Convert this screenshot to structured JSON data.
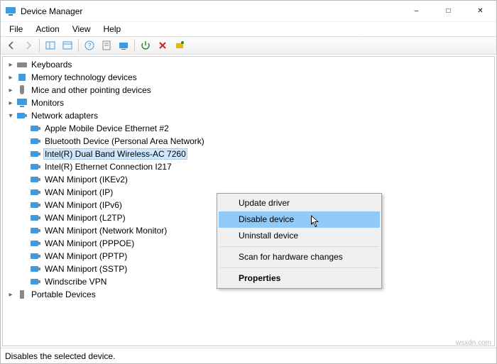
{
  "titlebar": {
    "title": "Device Manager"
  },
  "menubar": {
    "file": "File",
    "action": "Action",
    "view": "View",
    "help": "Help"
  },
  "tree": {
    "keyboards": "Keyboards",
    "memory_tech": "Memory technology devices",
    "mice": "Mice and other pointing devices",
    "monitors": "Monitors",
    "network_adapters": "Network adapters",
    "na_items": {
      "apple": "Apple Mobile Device Ethernet #2",
      "bt": "Bluetooth Device (Personal Area Network)",
      "intel_wireless": "Intel(R) Dual Band Wireless-AC 7260",
      "intel_eth": "Intel(R) Ethernet Connection I217",
      "wan_ikev2": "WAN Miniport (IKEv2)",
      "wan_ip": "WAN Miniport (IP)",
      "wan_ipv6": "WAN Miniport (IPv6)",
      "wan_l2tp": "WAN Miniport (L2TP)",
      "wan_netmon": "WAN Miniport (Network Monitor)",
      "wan_pppoe": "WAN Miniport (PPPOE)",
      "wan_pptp": "WAN Miniport (PPTP)",
      "wan_sstp": "WAN Miniport (SSTP)",
      "windscribe": "Windscribe VPN"
    },
    "portable": "Portable Devices"
  },
  "context_menu": {
    "update_driver": "Update driver",
    "disable_device": "Disable device",
    "uninstall_device": "Uninstall device",
    "scan": "Scan for hardware changes",
    "properties": "Properties"
  },
  "statusbar": {
    "text": "Disables the selected device."
  },
  "watermark": "wsxdn.com"
}
